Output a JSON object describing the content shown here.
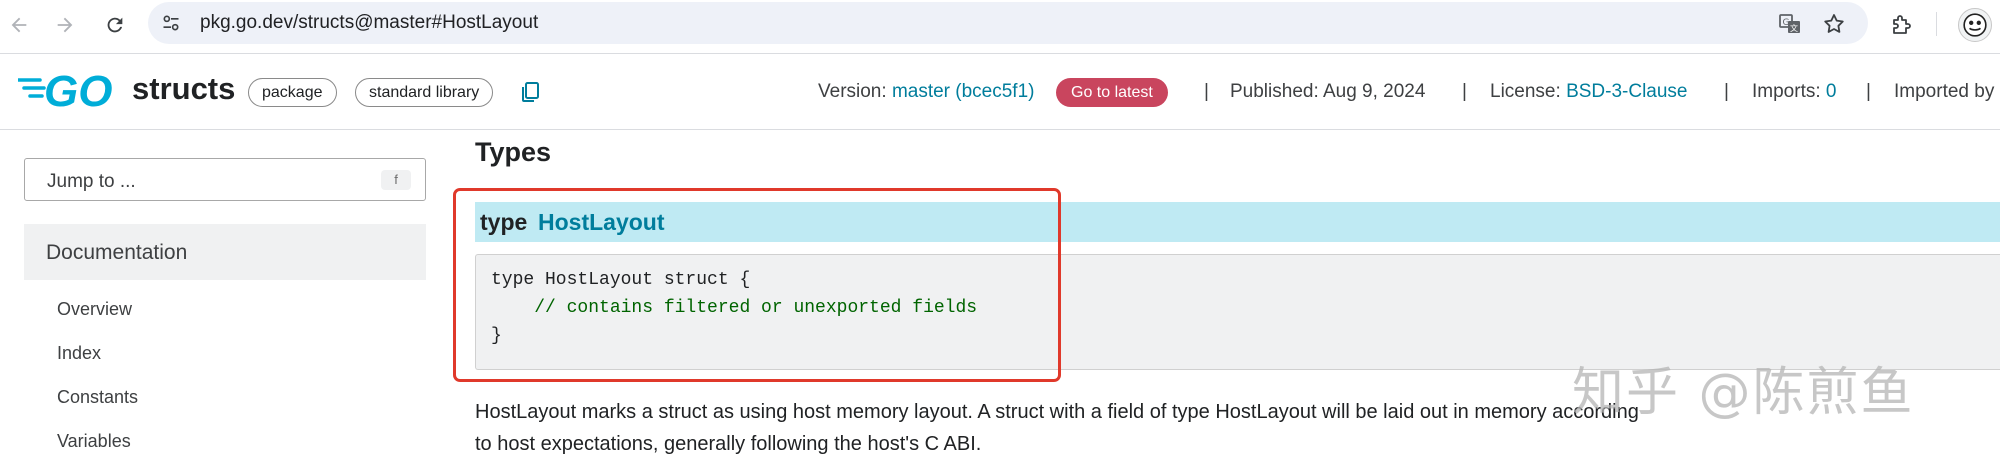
{
  "browser": {
    "url": "pkg.go.dev/structs@master#HostLayout"
  },
  "header": {
    "package_name": "structs",
    "chips": [
      "package",
      "standard library"
    ],
    "version_label": "Version:",
    "version_value": "master (bcec5f1)",
    "go_to_latest": "Go to latest",
    "separator": "|",
    "published": "Published: Aug 9, 2024",
    "license_label": "License:",
    "license_value": "BSD-3-Clause",
    "imports_label": "Imports:",
    "imports_value": "0",
    "imported_by_label": "Imported by"
  },
  "sidebar": {
    "jump_placeholder": "Jump to ...",
    "jump_shortcut": "f",
    "section_title": "Documentation",
    "items": [
      "Overview",
      "Index",
      "Constants",
      "Variables"
    ]
  },
  "main": {
    "section_title": "Types",
    "type_keyword": "type",
    "type_name": "HostLayout",
    "code_lines": [
      "type HostLayout struct {",
      "    // contains filtered or unexported fields",
      "}"
    ],
    "description_line1": "HostLayout marks a struct as using host memory layout. A struct with a field of type HostLayout will be laid out in memory according",
    "description_line2": "to host expectations, generally following the host's C ABI."
  },
  "watermark": "知乎 @陈煎鱼",
  "colors": {
    "link": "#007d9c",
    "latest_button": "#c9455e",
    "type_bar": "#bfeaf3",
    "highlight": "#e0392b",
    "go_blue": "#00add8"
  },
  "icons": {
    "back": "back-arrow-icon",
    "forward": "forward-arrow-icon",
    "reload": "reload-icon",
    "site_info": "tune-icon",
    "translate": "translate-icon",
    "bookmark": "star-icon",
    "extensions": "puzzle-icon",
    "copy": "copy-icon"
  }
}
